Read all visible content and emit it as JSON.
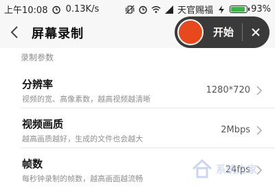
{
  "status_bar": {
    "time": "上午10:08",
    "speed": "0.13K/s",
    "carrier": "天官赐福",
    "battery": "93%",
    "battery_level": 0.93,
    "battery_color": "#3cb34a"
  },
  "header": {
    "title": "屏幕录制",
    "back_icon": "chevron-left-icon"
  },
  "recorder": {
    "start_label": "开始",
    "record_color": "#e8491c",
    "close_icon": "close-icon"
  },
  "section": {
    "title": "录制参数"
  },
  "settings": [
    {
      "title": "分辨率",
      "subtitle": "视频的宽、高像素数，越高视频越清晰",
      "value": "1280*720"
    },
    {
      "title": "视频画质",
      "subtitle": "越高画质越好，生成的文件也会越大",
      "value": "2Mbps"
    },
    {
      "title": "帧数",
      "subtitle": "每秒钟录制的帧数，越高画面越流畅",
      "value": "24fps"
    }
  ],
  "watermark": {
    "text": "系统之家"
  }
}
